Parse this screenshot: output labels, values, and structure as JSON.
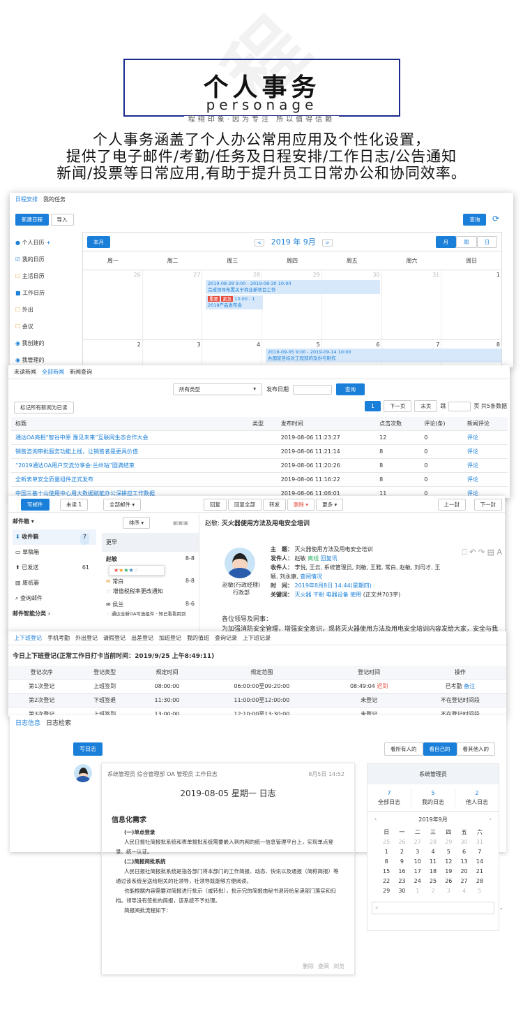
{
  "header": {
    "title": "个人事务",
    "subtitle": "personage",
    "slogan": "程翔印象·因为专注 所以值得信赖"
  },
  "intro": [
    "个人事务涵盖了个人办公常用应用及个性化设置，",
    "提供了电子邮件/考勤/任务及日程安排/工作日志/公告通知",
    "新闻/投票等日常应用,有助于提升员工日常办公和协同效率。"
  ],
  "schedule": {
    "tabs": [
      "日程安排",
      "我的任务"
    ],
    "new_btn": "新建日程",
    "import_btn": "导入",
    "query_btn": "查询",
    "month_btn": "本月",
    "month_label": "2019 年 9月",
    "view_month": "月",
    "view_week": "周",
    "view_day": "日",
    "sidebar": [
      "个人日历",
      "我的日历",
      "主活日历",
      "工作日历",
      "外出",
      "会议",
      "我创建的",
      "我管理的"
    ],
    "weekdays": [
      "周一",
      "周二",
      "周三",
      "周四",
      "周五",
      "周六",
      "周日"
    ],
    "week1": [
      "26",
      "27",
      "28",
      "29",
      "30",
      "31",
      "1"
    ],
    "week2": [
      "2",
      "3",
      "4",
      "5",
      "6",
      "7",
      "8"
    ],
    "event1": "2019-08-28 9:00 - 2019-08-30 10:00",
    "event1b": "完成领导布置关于商业新项目工作",
    "tag1": "重要",
    "tag2": "紧急",
    "event2": "13:00 - 1",
    "event2b": "2018产品发布会",
    "event3": "2019-09-05 9:00 - 2019-09-14 10:00",
    "event3b": "办国宣目标对工程部的及份与制作"
  },
  "news": {
    "tabs": [
      "未读新闻",
      "全部新闻",
      "新闻查询"
    ],
    "type_select": "所有类型",
    "date_label": "发布日期",
    "query_btn": "查询",
    "mark_btn": "标记所有新闻为已读",
    "page_num": "1",
    "next_btn": "下一页",
    "last_btn": "末页",
    "jump": "跳",
    "total": "页 共5条数据",
    "headers": [
      "标题",
      "类型",
      "发布时间",
      "点击次数",
      "评论(条)",
      "新闻评论"
    ],
    "rows": [
      [
        "通达OA亮相“智谷中原 豫见未来”互联网生态合作大会",
        "",
        "2019-08-06 11:23:27",
        "12",
        "0",
        "评论"
      ],
      [
        "销售咨询审批服务功能上线，让销售者是更具价值",
        "",
        "2019-08-06 11:21:14",
        "8",
        "0",
        "评论"
      ],
      [
        "“2019通达OA用户交流分享会·兰州站”圆满结束",
        "",
        "2019-08-06 11:20:26",
        "8",
        "0",
        "评论"
      ],
      [
        "全新表单安全质量组件正式发布",
        "",
        "2019-08-06 11:16:22",
        "8",
        "0",
        "评论"
      ],
      [
        "中国三基十山使用中心用大数据赋能办公深耕应工作数据",
        "",
        "2019-08-06 11:08:01",
        "11",
        "0",
        "评论"
      ]
    ]
  },
  "mail": {
    "write_btn": "写邮件",
    "unread_btn": "未读 1",
    "all_btn": "全部邮件",
    "reply": "回复",
    "reply_all": "回复全部",
    "forward": "转发",
    "delete": "删除",
    "more": "更多",
    "prev": "上一封",
    "next": "下一封",
    "folders_title": "邮件箱",
    "folders": [
      [
        "收件箱",
        "7"
      ],
      [
        "草稿箱",
        ""
      ],
      [
        "已发送",
        "61"
      ],
      [
        "废纸篓",
        ""
      ],
      [
        "查询邮件",
        ""
      ]
    ],
    "smart": "邮件智能分类",
    "sort_btn": "排序",
    "date_group": "更早",
    "list": [
      [
        "赵敏",
        "8-8"
      ],
      [
        "常白",
        "8-8"
      ],
      [
        "增值税税率更改通知",
        ""
      ],
      [
        "侯兰",
        "8-6"
      ],
      [
        "通达全新OA可选组件 · 知己看看用到",
        ""
      ]
    ],
    "subject_prefix": "赵敏:",
    "subject": "灭火器使用方法及用电安全培训",
    "theme_label": "主　题：",
    "theme": "灭火器使用方法及用电安全培训",
    "sender_label": "发件人：",
    "sender": "赵敏",
    "sender_status": "离线",
    "sender_action": "回复讯",
    "receiver_label": "收件人：",
    "receivers": "李悦, 王云, 系统管理员, 刘敏, 王雅, 常白, 赵敏, 刘司才, 王颖, 刘永康,",
    "receiver_link": "查阅情况",
    "time_label": "时　间：",
    "time": "2019年8月8日 14:44(星期四)",
    "keywords_label": "关键词：",
    "keywords": "灭火器 干粉 电器设备 使用",
    "text_size": "(正文共703字)",
    "person": "赵敏(行政经理)",
    "dept": "行政部",
    "greeting": "各位领导及同事：",
    "body": "为加强消防安全管理，增强安全意识，现将灭火器使用方法及用电安全培训内容发给大家，安全与我们息息"
  },
  "attendance": {
    "tabs": [
      "上下班登记",
      "手机考勤",
      "外出登记",
      "请假登记",
      "出差登记",
      "加班登记",
      "我的值班",
      "查询记录",
      "上下班记录"
    ],
    "title": "今日上下班登记(正常工作日打卡当前时间：2019/9/25 上午8:49:11)",
    "headers": [
      "登记次序",
      "登记类型",
      "规定时间",
      "规定范围",
      "登记时间",
      "操作"
    ],
    "rows": [
      [
        "第1次登记",
        "上班签到",
        "08:00:00",
        "06:00:00至09:20:00",
        "08:49:04",
        "迟到",
        "已考勤",
        "备注"
      ],
      [
        "第2次登记",
        "下班签退",
        "11:30:00",
        "11:00:00至12:00:00",
        "未登记",
        "",
        "不在登记时间段",
        ""
      ],
      [
        "第3次登记",
        "上班签到",
        "13:00:00",
        "12:10:00至13:30:00",
        "未登记",
        "",
        "不在登记时间段",
        ""
      ]
    ]
  },
  "log": {
    "tabs": [
      "日志信息",
      "日志检索"
    ],
    "write_btn": "写日志",
    "filter": [
      "看所有人的",
      "看自己的",
      "看其他人的"
    ],
    "meta": "系统管理员  综合管理部  OA 管理员  工作日志",
    "time": "8月5日 14:52",
    "title": "2019-08-05 星期一 日志",
    "h1": "信息化需求",
    "s1": "(一)单点登录",
    "p1": "人民日报社简报批系统和表单报批系统需要嵌入到内网的统一信息管理平台上，实现单点登录、统一认证。",
    "s2": "(二)简报阅批系统",
    "p2": "人民日报社简报批系统是指各部门将本部门的工作简报、动态、快讯以及通报（简称简报）等通过该系统呈送给相关的社领导，社领导既能够方便阅读。",
    "p3": "也能根据内容需要对简报进行批示（或转批），批示完的简报由秘书退转给呈递部门落实和归档。领导没有签批的简报，该系统不予处理。",
    "p4": "简报阅批流程如下：",
    "footer": [
      "删除",
      "查阅",
      "浏览"
    ],
    "side_title": "系统管理员",
    "stats": [
      [
        "7",
        "全部日志"
      ],
      [
        "5",
        "我的日志"
      ],
      [
        "2",
        "他人日志"
      ]
    ],
    "cal_title": "2019年9月",
    "cal_head": [
      "日",
      "一",
      "二",
      "三",
      "四",
      "五",
      "六"
    ],
    "cal": [
      [
        "25",
        "26",
        "27",
        "28",
        "29",
        "30",
        "31"
      ],
      [
        "1",
        "2",
        "3",
        "4",
        "5",
        "6",
        "7"
      ],
      [
        "8",
        "9",
        "10",
        "11",
        "12",
        "13",
        "14"
      ],
      [
        "15",
        "16",
        "17",
        "18",
        "19",
        "20",
        "21"
      ],
      [
        "22",
        "23",
        "24",
        "25",
        "26",
        "27",
        "28"
      ],
      [
        "29",
        "30",
        "1",
        "2",
        "3",
        "4",
        "5"
      ]
    ]
  }
}
